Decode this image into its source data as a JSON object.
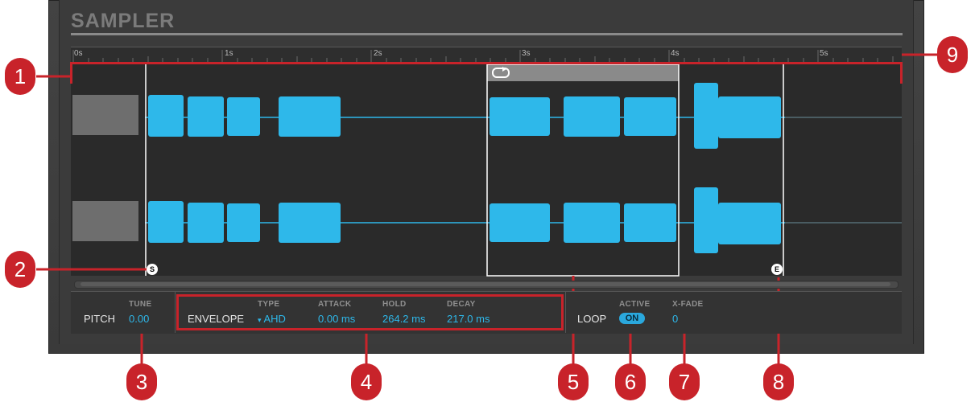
{
  "app": {
    "title": "SAMPLER"
  },
  "ruler": {
    "labels": [
      "0s",
      "1s",
      "2s",
      "3s",
      "4s",
      "5s"
    ]
  },
  "controls": {
    "pitch": {
      "label": "PITCH",
      "tune_label": "TUNE",
      "tune_value": "0.00"
    },
    "envelope": {
      "label": "ENVELOPE",
      "type_label": "TYPE",
      "type_value": "AHD",
      "attack_label": "ATTACK",
      "attack_value": "0.00 ms",
      "hold_label": "HOLD",
      "hold_value": "264.2 ms",
      "decay_label": "DECAY",
      "decay_value": "217.0 ms"
    },
    "loop": {
      "label": "LOOP",
      "active_label": "ACTIVE",
      "active_value": "ON",
      "xfade_label": "X-FADE",
      "xfade_value": "0"
    }
  },
  "markers": {
    "start": "S",
    "end": "E"
  },
  "callouts": [
    "1",
    "2",
    "3",
    "4",
    "5",
    "6",
    "7",
    "8",
    "9"
  ],
  "colors": {
    "waveform": "#2eb8ea",
    "callout": "#c8232a",
    "grey_wave": "#6e6e6e"
  },
  "icons": {
    "loop": "loop-icon",
    "dropdown": "dropdown-arrow-icon"
  }
}
